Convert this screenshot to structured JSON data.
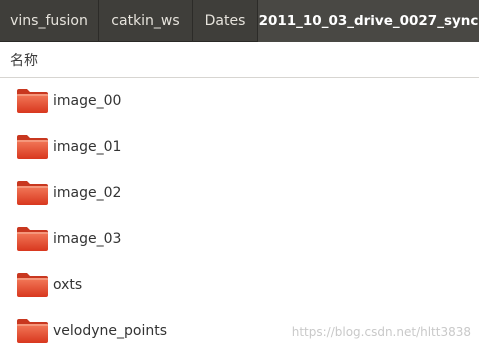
{
  "tabs": [
    {
      "label": "vins_fusion",
      "active": false
    },
    {
      "label": "catkin_ws",
      "active": false
    },
    {
      "label": "Dates",
      "active": false
    },
    {
      "label": "2011_10_03_drive_0027_sync",
      "active": true
    }
  ],
  "column_header": {
    "name_label": "名称"
  },
  "files": [
    {
      "name": "image_00",
      "icon": "folder-icon"
    },
    {
      "name": "image_01",
      "icon": "folder-icon"
    },
    {
      "name": "image_02",
      "icon": "folder-icon"
    },
    {
      "name": "image_03",
      "icon": "folder-icon"
    },
    {
      "name": "oxts",
      "icon": "folder-icon"
    },
    {
      "name": "velodyne_points",
      "icon": "folder-icon"
    }
  ],
  "watermark": "https://blog.csdn.net/hltt3838",
  "colors": {
    "tabbar": "#3f3e3a",
    "active_tab": "#494844",
    "folder": "#e8472a"
  }
}
